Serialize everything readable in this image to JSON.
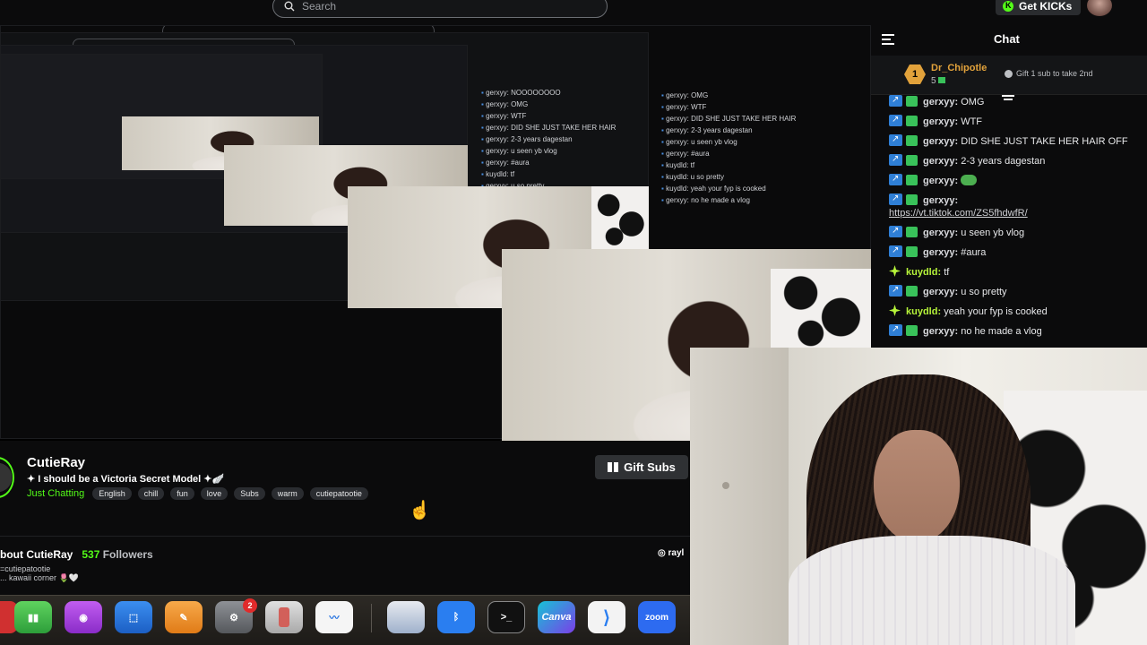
{
  "topbar": {
    "search_placeholder": "Search",
    "get_kicks_label": "Get KICKs"
  },
  "chat": {
    "title": "Chat",
    "pinned": {
      "rank": "1",
      "user": "Dr_Chipotle",
      "count": "5",
      "message": "Gift 1 sub to take 2nd"
    },
    "messages": [
      {
        "badge": "sub",
        "user": "gerxyy:",
        "text": "OMG"
      },
      {
        "badge": "sub",
        "user": "gerxyy:",
        "text": "WTF"
      },
      {
        "badge": "sub",
        "user": "gerxyy:",
        "text": "DID SHE JUST TAKE HER HAIR OFF"
      },
      {
        "badge": "sub",
        "user": "gerxyy:",
        "text": "2-3 years dagestan"
      },
      {
        "badge": "sub",
        "user": "gerxyy:",
        "text": ""
      },
      {
        "badge": "sub",
        "user": "gerxyy:",
        "text": "https://vt.tiktok.com/ZS5fhdwfR/"
      },
      {
        "badge": "sub",
        "user": "gerxyy:",
        "text": "u seen yb vlog"
      },
      {
        "badge": "sub",
        "user": "gerxyy:",
        "text": "#aura"
      },
      {
        "badge": "star",
        "user": "kuydld:",
        "text": "tf"
      },
      {
        "badge": "sub",
        "user": "gerxyy:",
        "text": "u so pretty"
      },
      {
        "badge": "star",
        "user": "kuydld:",
        "text": "yeah your fyp is cooked"
      },
      {
        "badge": "sub",
        "user": "gerxyy:",
        "text": "no he made a vlog"
      }
    ]
  },
  "stream": {
    "streamer": "CutieRay",
    "title": "✦ I should be a Victoria Secret Model ✦🪽",
    "category": "Just Chatting",
    "tags": [
      "English",
      "chill",
      "fun",
      "love",
      "Subs",
      "warm",
      "cutiepatootie"
    ],
    "gift_subs_label": "Gift Subs"
  },
  "about": {
    "heading": "bout CutieRay",
    "followers_count": "537",
    "followers_label": "Followers",
    "line1": "=cutiepatootie",
    "line2": "... kawaii corner 🌷🤍",
    "instagram": "rayl"
  },
  "dock": {
    "items": [
      "numbers-app",
      "podcasts-app",
      "keynote-app",
      "pages-app",
      "system-settings-app",
      "iphone-mirroring-app",
      "freeform-app",
      "preview-app",
      "bluetooth-app",
      "terminal-app",
      "Canva",
      "vscode-app",
      "zoom"
    ],
    "settings_badge": "2"
  },
  "colors": {
    "accent": "#53fc18",
    "gold": "#e2a23b",
    "panel": "#0b0b0c"
  }
}
